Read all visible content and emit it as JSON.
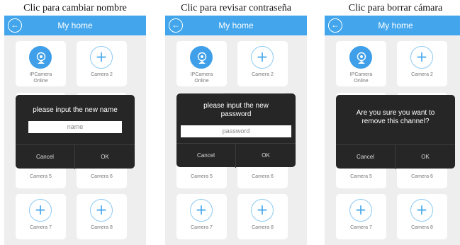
{
  "panels": [
    {
      "caption": "Clic para cambiar nombre",
      "title": "My home",
      "cameras": [
        {
          "name": "IPCamera",
          "status": "Online"
        },
        {
          "name": "Camera 2"
        },
        {
          "name": "Camera 5"
        },
        {
          "name": "Camera 6"
        },
        {
          "name": "Camera 7"
        },
        {
          "name": "Camera 8"
        }
      ],
      "dialog": {
        "message": "please input the new name",
        "placeholder": "name",
        "cancel": "Cancel",
        "ok": "OK"
      }
    },
    {
      "caption": "Clic para revisar contraseña",
      "title": "My home",
      "cameras": [
        {
          "name": "IPCamera",
          "status": "Online"
        },
        {
          "name": "Camera 2"
        },
        {
          "name": "Camera 5"
        },
        {
          "name": "Camera 6"
        },
        {
          "name": "Camera 7"
        },
        {
          "name": "Camera 8"
        }
      ],
      "dialog": {
        "message": "please input the new password",
        "placeholder": "password",
        "cancel": "Cancel",
        "ok": "OK"
      }
    },
    {
      "caption": "Clic para borrar cámara",
      "title": "My home",
      "cameras": [
        {
          "name": "IPCamera",
          "status": "Online"
        },
        {
          "name": "Camera 2"
        },
        {
          "name": "Camera 5"
        },
        {
          "name": "Camera 6"
        },
        {
          "name": "Camera 7"
        },
        {
          "name": "Camera 8"
        }
      ],
      "dialog": {
        "message": "Are you sure you want to remove this channel?",
        "cancel": "Cancel",
        "ok": "OK"
      }
    }
  ],
  "icons": {
    "back": "back-arrow-icon",
    "add": "plus-icon",
    "camera": "webcam-icon"
  },
  "colors": {
    "accent": "#43a6ec",
    "dialog": "#262626",
    "background": "#eeeeee"
  }
}
